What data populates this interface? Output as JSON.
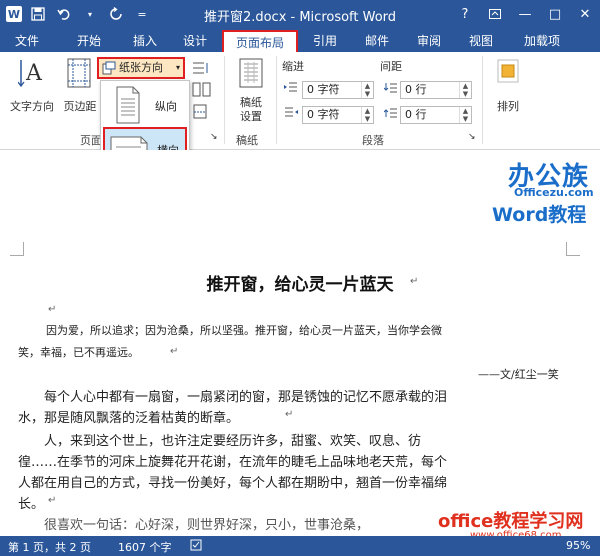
{
  "title_bar": {
    "title": "推开窗2.docx - Microsoft Word",
    "help": "?",
    "minimize": "—",
    "restore": "□",
    "close": "✕",
    "qat": [
      "W",
      "💾",
      "↶",
      "↻",
      "="
    ]
  },
  "tabs": [
    "文件",
    "开始",
    "插入",
    "设计",
    "页面布局",
    "引用",
    "邮件",
    "审阅",
    "视图",
    "加载项"
  ],
  "ribbon": {
    "text_direction": "文字方向",
    "margins": "页边距",
    "orientation": "纸张方向",
    "manuscript": "稿纸设置",
    "manuscript_line1": "稿纸",
    "manuscript_line2": "设置",
    "page_setup_group": "页面",
    "manuscript_group": "稿纸",
    "paragraph_group": "段落",
    "indent_label": "缩进",
    "spacing_label": "间距",
    "indent_left": "0 字符",
    "indent_right": "0 字符",
    "spacing_before": "0 行",
    "spacing_after": "0 行",
    "arrange": "排列"
  },
  "orientation_menu": {
    "portrait": "纵向",
    "landscape": "横向"
  },
  "logo": {
    "brand": "办公族",
    "site": "Officezu.com",
    "tutorial": "Word教程"
  },
  "document": {
    "title": "推开窗，给心灵一片蓝天",
    "p1_line1": "因为爱，所以追求；因为沧桑，所以坚强。推开窗，给心灵一片蓝天，当你学会微",
    "p1_line2": "笑，幸福，已不再遥远。",
    "byline": "——文/红尘一笑",
    "p2_line1": "每个人心中都有一扇窗，一扇紧闭的窗，那是锈蚀的记忆不愿承载的泪",
    "p2_line2": "水，那是随风飘落的泛着枯黄的断章。",
    "p3_line1": "人，来到这个世上，也许注定要经历许多，甜蜜、欢笑、叹息、彷",
    "p3_line2": "徨……在季节的河床上旋舞花开花谢，在流年的睫毛上品味地老天荒，每个",
    "p3_line3": "人都在用自己的方式，寻找一份美好，每个人都在期盼中，翘首一份幸福绵",
    "p3_line4": "长。",
    "p4_line1": "很喜欢一句话：心好深，则世界好深，只小，世事沧桑，"
  },
  "watermark": {
    "text": "office教程学习网",
    "url": "www.office68.com"
  },
  "status_bar": {
    "page": "第 1 页，共 2 页",
    "words": "1607 个字",
    "zoom": "95%"
  }
}
